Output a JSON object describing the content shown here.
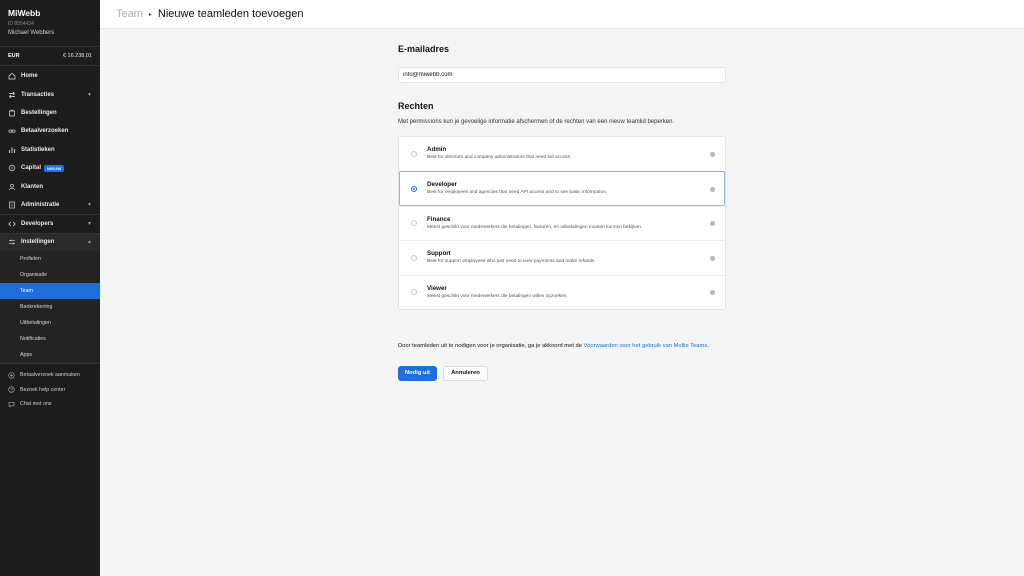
{
  "account": {
    "name": "MiWebb",
    "id": "ID 8554434",
    "user": "Michael Webbers",
    "currency": "EUR",
    "balance": "€ 16.238,01"
  },
  "nav": {
    "home": "Home",
    "transactions": "Transacties",
    "orders": "Bestellingen",
    "payment_requests": "Betaalverzoeken",
    "statistics": "Statistieken",
    "capital": "Capital",
    "capital_badge": "NIEUW",
    "customers": "Klanten",
    "administration": "Administratie",
    "developers": "Developers",
    "settings": "Instellingen",
    "settings_sub": [
      "Profielen",
      "Organisatie",
      "Team",
      "Bankrekening",
      "Uitbetalingen",
      "Notificaties",
      "Apps"
    ],
    "settings_active_index": 2
  },
  "utility": {
    "create_request": "Betaalverzoek aanmaken",
    "help_center": "Bezoek help center",
    "chat": "Chat met ons"
  },
  "breadcrumb": {
    "parent": "Team",
    "current": "Nieuwe teamleden toevoegen"
  },
  "form": {
    "email_heading": "E-mailadres",
    "email_value": "info@miwebb.com",
    "rights_heading": "Rechten",
    "rights_description": "Met permissions kun je gevoelige informatie afschermen of de rechten van een nieuw teamlid beperken.",
    "roles": [
      {
        "title": "Admin",
        "description": "Best for directors and company administrators that need full access."
      },
      {
        "title": "Developer",
        "description": "Best for employees and agencies that need API access and to see basic information."
      },
      {
        "title": "Finance",
        "description": "Meest geschikt voor medewerkers die betalingen, facturen, en uitbetalingen moeten kunnen bekijken."
      },
      {
        "title": "Support",
        "description": "Best for support employees who just need to view payments and make refunds."
      },
      {
        "title": "Viewer",
        "description": "Meest geschikt voor medewerkers die betalingen willen opzoeken."
      }
    ],
    "selected_role_index": 1,
    "terms_text": "Door teamleden uit te nodigen voor je organisatie, ga je akkoord met de ",
    "terms_link": "Voorwaarden voor het gebruik van Mollie Teams",
    "terms_end": ".",
    "invite_button": "Nodig uit",
    "cancel_button": "Annuleren"
  },
  "colors": {
    "accent": "#1e6fd9",
    "sidebar_bg": "#1c1c1c"
  }
}
